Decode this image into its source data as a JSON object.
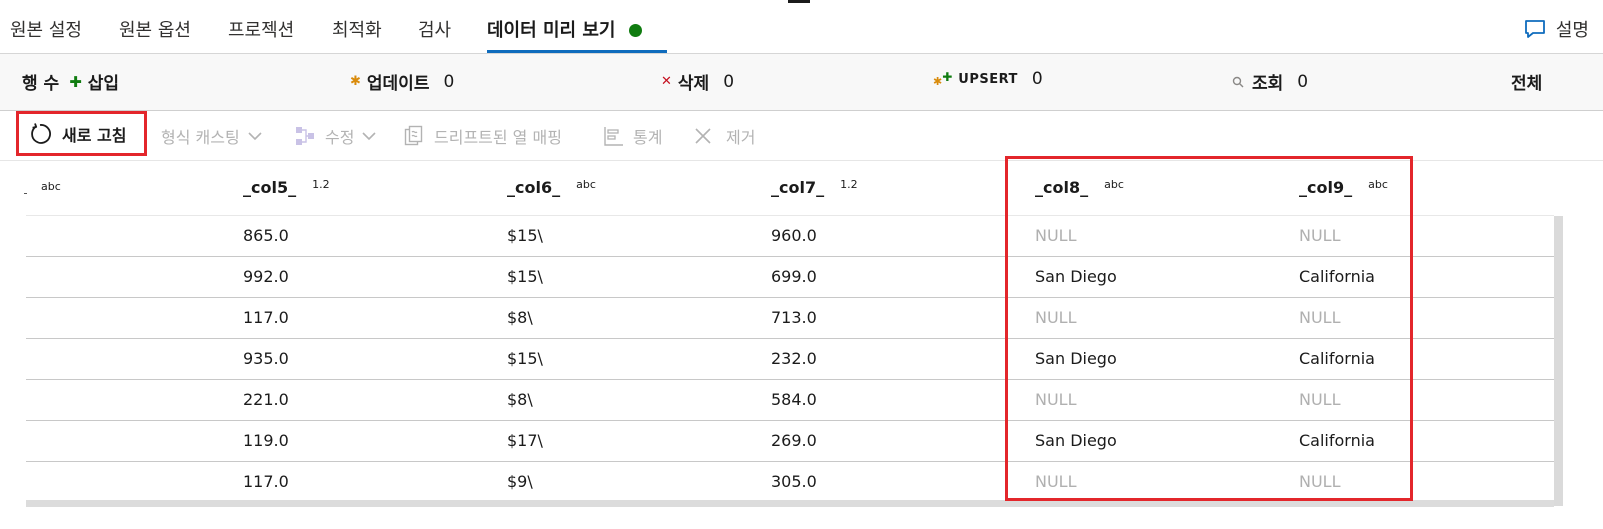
{
  "tabs": [
    {
      "label": "원본 설정"
    },
    {
      "label": "원본 옵션"
    },
    {
      "label": "프로젝션"
    },
    {
      "label": "최적화"
    },
    {
      "label": "검사"
    },
    {
      "label": "데이터 미리 보기"
    }
  ],
  "active_tab_status_color": "#107c10",
  "explain": {
    "label": "설명",
    "icon": "chat-bubble-icon"
  },
  "stats": {
    "rows": {
      "label": "행 수"
    },
    "insert": {
      "label": "삽입",
      "icon": "plus-icon"
    },
    "update": {
      "label": "업데이트",
      "count": "0",
      "icon": "asterisk-icon"
    },
    "delete": {
      "label": "삭제",
      "count": "0",
      "icon": "x-icon"
    },
    "upsert": {
      "label": "UPSERT",
      "count": "0",
      "icon": "upsert-icon"
    },
    "lookup": {
      "label": "조회",
      "count": "0",
      "icon": "search-icon"
    },
    "total": {
      "label": "전체"
    }
  },
  "toolbar": {
    "refresh": {
      "label": "새로 고침",
      "icon": "refresh-icon"
    },
    "typecast": {
      "label": "형식 캐스팅",
      "icon": "chevron-down-icon"
    },
    "modify": {
      "label": "수정",
      "icon": "modify-icon"
    },
    "drift": {
      "label": "드리프트된 열 매핑",
      "icon": "drift-map-icon"
    },
    "stats": {
      "label": "통계",
      "icon": "stats-icon"
    },
    "remove": {
      "label": "제거",
      "icon": "close-icon"
    }
  },
  "table": {
    "leading_type": "abc",
    "columns": [
      {
        "name": "_col5_",
        "type": "1.2"
      },
      {
        "name": "_col6_",
        "type": "abc"
      },
      {
        "name": "_col7_",
        "type": "1.2"
      },
      {
        "name": "_col8_",
        "type": "abc"
      },
      {
        "name": "_col9_",
        "type": "abc"
      }
    ],
    "rows": [
      [
        "865.0",
        "$15\\",
        "960.0",
        "NULL",
        "NULL"
      ],
      [
        "992.0",
        "$15\\",
        "699.0",
        "San Diego",
        "California"
      ],
      [
        "117.0",
        "$8\\",
        "713.0",
        "NULL",
        "NULL"
      ],
      [
        "935.0",
        "$15\\",
        "232.0",
        "San Diego",
        "California"
      ],
      [
        "221.0",
        "$8\\",
        "584.0",
        "NULL",
        "NULL"
      ],
      [
        "119.0",
        "$17\\",
        "269.0",
        "San Diego",
        "California"
      ],
      [
        "117.0",
        "$9\\",
        "305.0",
        "NULL",
        "NULL"
      ]
    ]
  },
  "colors": {
    "accent": "#0f6cbd",
    "highlight": "#e3262b",
    "null_text": "#b0b0b0"
  }
}
